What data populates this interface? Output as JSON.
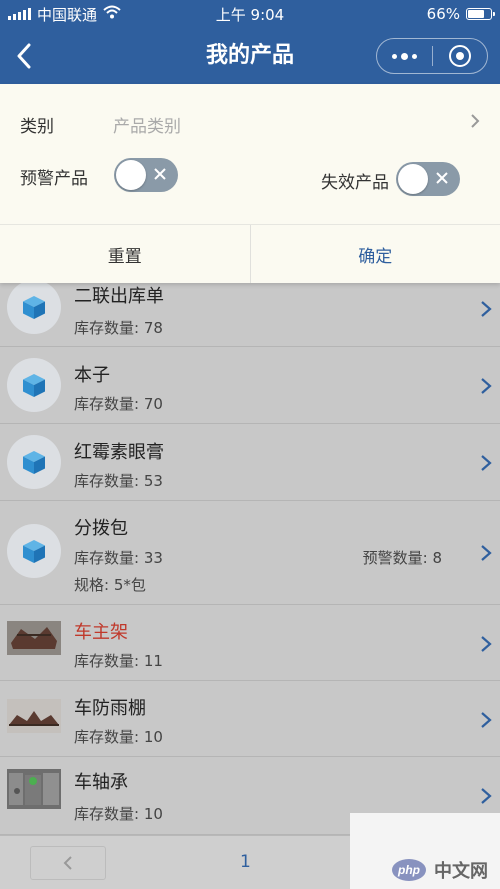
{
  "status_bar": {
    "carrier": "中国联通",
    "time": "上午 9:04",
    "battery": "66%"
  },
  "nav": {
    "title": "我的产品"
  },
  "filter": {
    "category_label": "类别",
    "category_placeholder": "产品类别",
    "warning_label": "预警产品",
    "warning_on": false,
    "expired_label": "失效产品",
    "expired_on": false,
    "reset_label": "重置",
    "confirm_label": "确定"
  },
  "products": [
    {
      "name": "二联出库单",
      "stock": "库存数量: 78",
      "thumb": "box-icon"
    },
    {
      "name": "本子",
      "stock": "库存数量: 70",
      "thumb": "box-icon"
    },
    {
      "name": "红霉素眼膏",
      "stock": "库存数量: 53",
      "thumb": "box-icon"
    },
    {
      "name": "分拨包",
      "stock": "库存数量: 33",
      "warning": "预警数量: 8",
      "spec": "规格: 5*包",
      "thumb": "box-icon"
    },
    {
      "name": "车主架",
      "stock": "库存数量: 11",
      "thumb": "photo",
      "highlight": true
    },
    {
      "name": "车防雨棚",
      "stock": "库存数量: 10",
      "thumb": "photo"
    },
    {
      "name": "车轴承",
      "stock": "库存数量: 10",
      "thumb": "photo"
    }
  ],
  "pagination": {
    "page": "1"
  },
  "watermark": {
    "logo": "php",
    "text": "中文网"
  },
  "colors": {
    "brand": "#2f5f9e",
    "warning_name": "#c0392b",
    "overlay": "#c8c8c8"
  }
}
